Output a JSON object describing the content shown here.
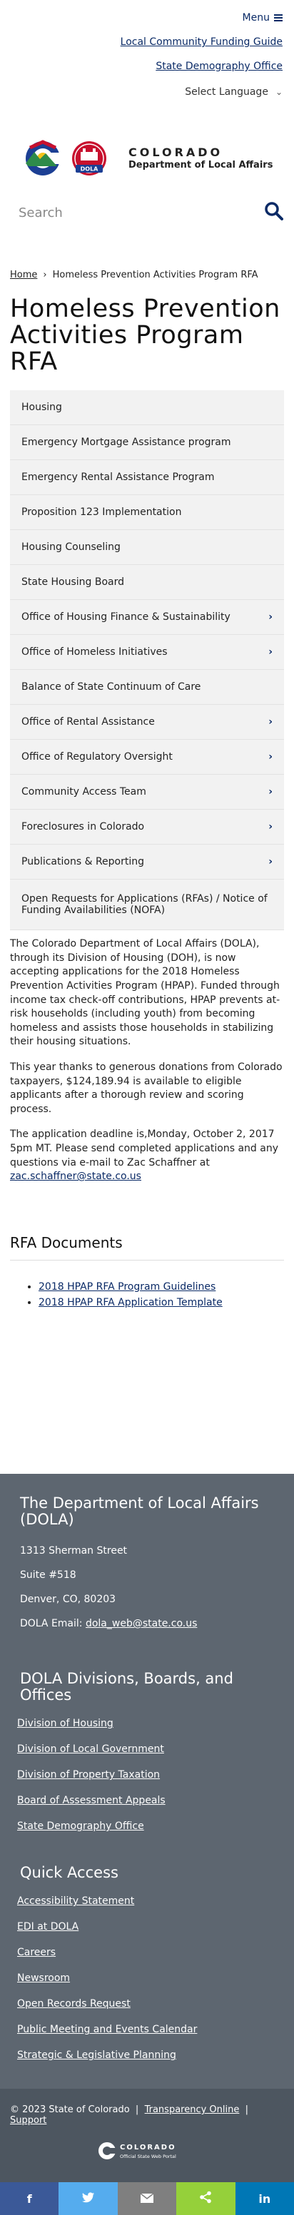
{
  "topnav": {
    "menu_label": "Menu",
    "link1": "Local Community Funding Guide",
    "link2": "State Demography Office",
    "language": "Select Language"
  },
  "logo": {
    "line1": "COLORADO",
    "line2": "Department of Local Affairs",
    "badge_text": "DOLA"
  },
  "search": {
    "placeholder": "Search"
  },
  "breadcrumb": {
    "home": "Home",
    "separator": "›",
    "current": "Homeless Prevention Activities Program RFA"
  },
  "page_title": "Homeless Prevention Activities Program RFA",
  "subnav": [
    {
      "label": "Housing",
      "has_children": false
    },
    {
      "label": "Emergency Mortgage Assistance program",
      "has_children": false
    },
    {
      "label": "Emergency Rental Assistance Program",
      "has_children": false
    },
    {
      "label": "Proposition 123 Implementation",
      "has_children": false
    },
    {
      "label": "Housing Counseling",
      "has_children": false
    },
    {
      "label": "State Housing Board",
      "has_children": false
    },
    {
      "label": "Office of Housing Finance & Sustainability",
      "has_children": true
    },
    {
      "label": "Office of Homeless Initiatives",
      "has_children": true
    },
    {
      "label": "Balance of State Continuum of Care",
      "has_children": false
    },
    {
      "label": "Office of Rental Assistance",
      "has_children": true
    },
    {
      "label": "Office of Regulatory Oversight",
      "has_children": true
    },
    {
      "label": "Community Access Team",
      "has_children": true
    },
    {
      "label": "Foreclosures in Colorado",
      "has_children": true
    },
    {
      "label": "Publications & Reporting",
      "has_children": true
    },
    {
      "label": "Open Requests for Applications (RFAs) / Notice of Funding Availabilities (NOFA)",
      "has_children": false
    }
  ],
  "body": {
    "p1": "The Colorado Department of Local Affairs (DOLA), through its Division of Housing (DOH), is now accepting applications for the 2018 Homeless Prevention Activities Program (HPAP). Funded through income tax check-off contributions, HPAP prevents at-risk households (including youth) from becoming homeless and assists those households in stabilizing their housing situations.",
    "p2": "This year thanks to generous donations from Colorado taxpayers, $124,189.94 is available to eligible applicants after a thorough review and scoring process.",
    "p3": "The application deadline is,Monday, October 2, 2017 5pm MT. Please send completed applications and any questions via e-mail to Zac Schaffner at",
    "email": "zac.schaffner@state.co.us"
  },
  "rfa": {
    "heading": "RFA Documents",
    "docs": [
      "2018 HPAP RFA Program Guidelines",
      "2018 HPAP RFA Application Template"
    ]
  },
  "footer": {
    "org_title": "The Department of Local Affairs (DOLA)",
    "address1": "1313 Sherman Street",
    "address2": "Suite  #518",
    "address3": "Denver, CO, 80203",
    "email_label": "DOLA Email: ",
    "email": "dola_web@state.co.us",
    "divisions_title": "DOLA Divisions, Boards, and Offices",
    "divisions": [
      "Division of Housing",
      "Division of Local Government",
      "Division of Property Taxation",
      "Board of Assessment Appeals",
      "State Demography Office"
    ],
    "quick_title": "Quick Access",
    "quick": [
      "Accessibility Statement",
      "EDI at DOLA",
      "Careers",
      "Newsroom",
      "Open Records Request",
      "Public Meeting and Events Calendar",
      "Strategic & Legislative Planning"
    ],
    "copyright": "© 2023 State of Colorado",
    "transparency": "Transparency Online",
    "support": "Support",
    "portal_line1": "COLORADO",
    "portal_line2": "Official State Web Portal"
  },
  "share": {
    "colors": {
      "facebook": "#3b5998",
      "twitter": "#55acee",
      "email": "#7f7f7f",
      "share": "#95d03a",
      "linkedin": "#0077b5"
    },
    "icons": [
      "facebook-icon",
      "twitter-icon",
      "email-icon",
      "share-icon",
      "linkedin-icon"
    ]
  }
}
